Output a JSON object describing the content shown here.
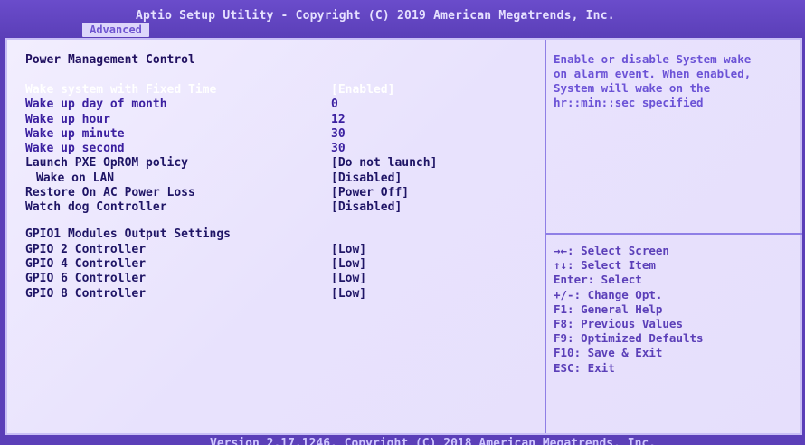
{
  "header": {
    "title": "Aptio Setup Utility - Copyright (C) 2019 American Megatrends, Inc.",
    "tab": "Advanced"
  },
  "section": {
    "title": "Power Management Control",
    "rows": [
      {
        "label": "Wake system with Fixed Time",
        "value": "[Enabled]"
      },
      {
        "label": "Wake up day of month",
        "value": "0"
      },
      {
        "label": "Wake up hour",
        "value": "12"
      },
      {
        "label": "Wake up minute",
        "value": "30"
      },
      {
        "label": "Wake up second",
        "value": "30"
      },
      {
        "label": "Launch PXE OpROM policy",
        "value": "[Do not launch]"
      },
      {
        "label": "Wake on LAN",
        "value": "[Disabled]"
      },
      {
        "label": "Restore On AC Power Loss",
        "value": "[Power Off]"
      },
      {
        "label": "Watch dog Controller",
        "value": "[Disabled]"
      }
    ]
  },
  "gpio": {
    "title": "GPIO1 Modules Output Settings",
    "rows": [
      {
        "label": "GPIO 2 Controller",
        "value": "[Low]"
      },
      {
        "label": "GPIO 4 Controller",
        "value": "[Low]"
      },
      {
        "label": "GPIO 6 Controller",
        "value": "[Low]"
      },
      {
        "label": "GPIO 8 Controller",
        "value": "[Low]"
      }
    ]
  },
  "help": {
    "lines": [
      "Enable or disable System wake",
      "on alarm event. When enabled,",
      "System will wake on the",
      "hr::min::sec specified"
    ]
  },
  "keys": {
    "lines": [
      "→←: Select Screen",
      "↑↓: Select Item",
      "Enter: Select",
      "+/-: Change Opt.",
      "F1: General Help",
      "F8: Previous Values",
      "F9: Optimized Defaults",
      "F10: Save & Exit",
      "ESC: Exit"
    ]
  },
  "footer": {
    "text": "Version 2.17.1246. Copyright (C) 2018 American Megatrends, Inc."
  }
}
